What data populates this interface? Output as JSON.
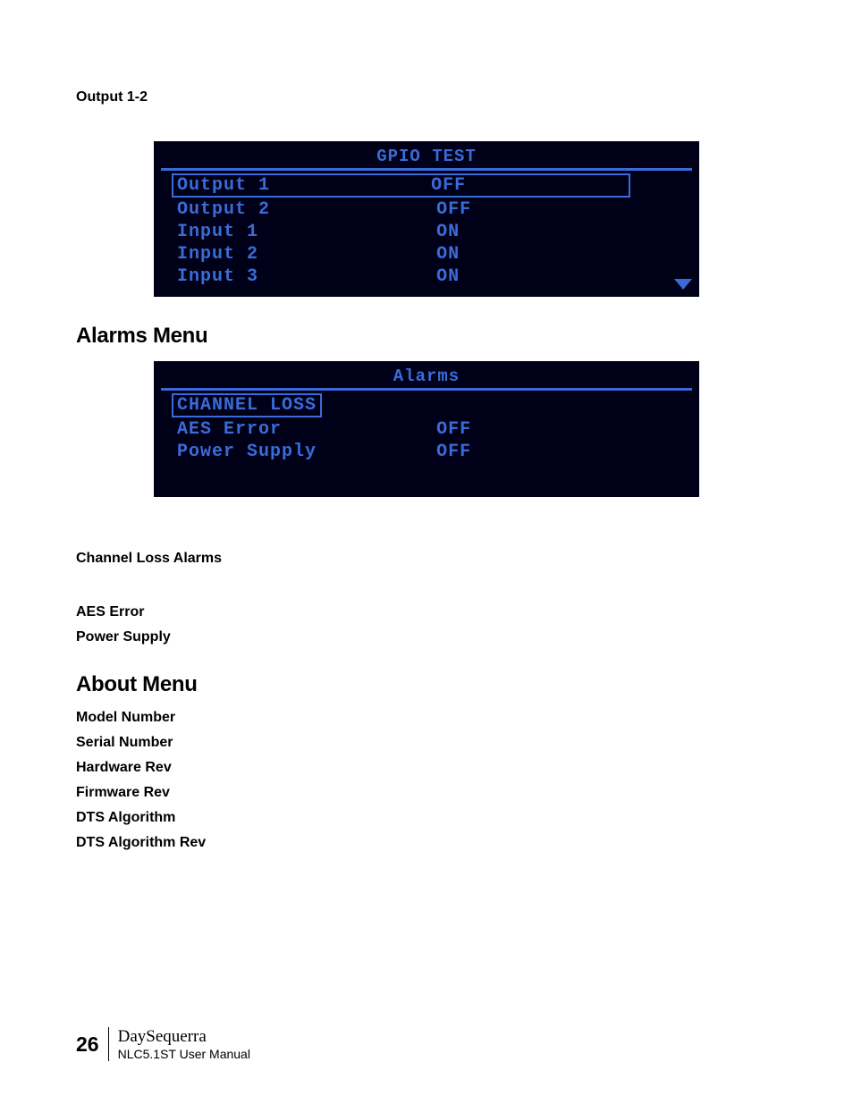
{
  "section1": {
    "label": "Output 1-2"
  },
  "screen1": {
    "title": "GPIO TEST",
    "rows": [
      {
        "label": "Output 1",
        "value": "OFF",
        "selected": true
      },
      {
        "label": "Output 2",
        "value": "OFF"
      },
      {
        "label": "Input 1",
        "value": "ON"
      },
      {
        "label": "Input 2",
        "value": "ON"
      },
      {
        "label": "Input 3",
        "value": "ON"
      }
    ]
  },
  "heading_alarms": "Alarms Menu",
  "screen2": {
    "title": "Alarms",
    "rows": [
      {
        "label": "CHANNEL LOSS",
        "value": "",
        "selected": true,
        "novalue": true
      },
      {
        "label": "AES Error",
        "value": "OFF"
      },
      {
        "label": "Power Supply",
        "value": "OFF"
      }
    ]
  },
  "alarm_sub": {
    "item1": "Channel Loss Alarms",
    "item2": "AES Error",
    "item3": "Power Supply"
  },
  "heading_about": "About Menu",
  "about": {
    "item1": "Model Number",
    "item2": "Serial Number",
    "item3": "Hardware Rev",
    "item4": "Firmware Rev",
    "item5": "DTS Algorithm",
    "item6": "DTS Algorithm Rev"
  },
  "footer": {
    "page": "26",
    "brand": "DaySequerra",
    "manual": "NLC5.1ST User Manual"
  }
}
